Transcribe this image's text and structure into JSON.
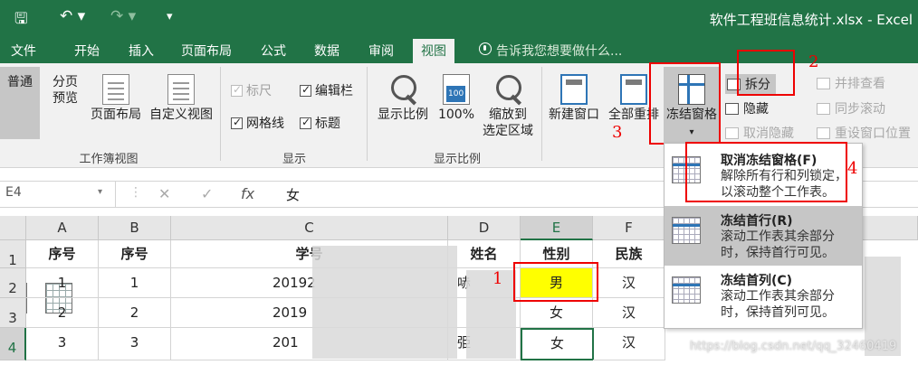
{
  "window": {
    "title": "软件工程班信息统计.xlsx - Excel"
  },
  "tabs": [
    {
      "label": "文件"
    },
    {
      "label": "开始"
    },
    {
      "label": "插入"
    },
    {
      "label": "页面布局"
    },
    {
      "label": "公式"
    },
    {
      "label": "数据"
    },
    {
      "label": "审阅"
    },
    {
      "label": "视图"
    }
  ],
  "tellme": "告诉我您想要做什么...",
  "ribbon": {
    "workbook_views": {
      "label": "工作簿视图",
      "normal": "普通",
      "page_break_1": "分页",
      "page_break_2": "预览",
      "page_layout": "页面布局",
      "custom_views": "自定义视图"
    },
    "show": {
      "label": "显示",
      "ruler": "标尺",
      "formula_bar": "编辑栏",
      "gridlines": "网格线",
      "headings": "标题"
    },
    "zoom": {
      "label": "显示比例",
      "zoom": "显示比例",
      "hundred": "100%",
      "to_selection_1": "缩放到",
      "to_selection_2": "选定区域"
    },
    "window": {
      "new_window": "新建窗口",
      "arrange_all": "全部重排",
      "freeze_panes": "冻结窗格",
      "split": "拆分",
      "hide": "隐藏",
      "unhide": "取消隐藏",
      "side_by_side": "并排查看",
      "sync_scroll": "同步滚动",
      "reset_position": "重设窗口位置"
    }
  },
  "annotations": {
    "one": "1",
    "two": "2",
    "three": "3",
    "four": "4"
  },
  "formula_bar": {
    "name_box": "E4",
    "cancel": "✕",
    "enter": "✓",
    "fx": "fx",
    "value": "女"
  },
  "columns": [
    "A",
    "B",
    "C",
    "D",
    "E",
    "F"
  ],
  "rows": [
    "1",
    "2",
    "3",
    "4"
  ],
  "cells": {
    "r1": [
      "序号",
      "序号",
      "学号",
      "姓名",
      "性别",
      "民族"
    ],
    "r2": [
      "1",
      "1",
      "20192",
      "哧",
      "男",
      "汉"
    ],
    "r3": [
      "2",
      "2",
      "2019",
      "",
      "女",
      "汉"
    ],
    "r4": [
      "3",
      "3",
      "201",
      "弫",
      "女",
      "汉"
    ]
  },
  "freeze_menu": [
    {
      "title": "取消冻结窗格(F)",
      "desc": "解除所有行和列锁定，以滚动整个工作表。"
    },
    {
      "title": "冻结首行(R)",
      "desc": "滚动工作表其余部分时，保持首行可见。"
    },
    {
      "title": "冻结首列(C)",
      "desc": "滚动工作表其余部分时，保持首列可见。"
    }
  ],
  "watermark": "https://blog.csdn.net/qq_32460419"
}
